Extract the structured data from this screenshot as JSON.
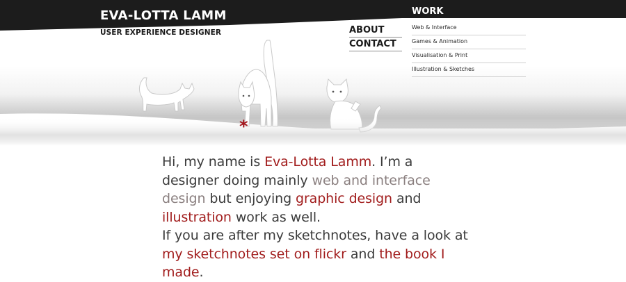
{
  "header": {
    "name": "EVA-LOTTA LAMM",
    "subtitle": "USER EXPERIENCE DESIGNER"
  },
  "nav": {
    "about": "ABOUT",
    "contact": "CONTACT"
  },
  "work_menu": {
    "title": "WORK",
    "items": [
      {
        "label": "Web & Interface"
      },
      {
        "label": "Games & Animation"
      },
      {
        "label": "Visualisation & Print"
      },
      {
        "label": "Illustration & Sketches"
      }
    ]
  },
  "decor": {
    "asterisk": "*",
    "illustration_icon": "cats-illustration"
  },
  "intro": {
    "p1_a": "Hi, my name is ",
    "p1_name_link": "Eva-Lotta Lamm",
    "p1_b": ". I’m a designer doing mainly ",
    "p1_web_link": "web and interface design",
    "p1_c": " but enjoying ",
    "p1_graphic_link": "graphic design",
    "p1_d": " and ",
    "p1_illustration_link": "illustration",
    "p1_e": " work as well.",
    "p2_a": "If you are after my sketchnotes, have a look at ",
    "p2_flickr_link": "my sketchnotes set on flickr",
    "p2_b": " and ",
    "p2_book_link": "the book I made",
    "p2_c": "."
  },
  "colors": {
    "brand_red": "#a11c1c",
    "dark_band": "#1c1c1c",
    "muted_link": "#8a7f7f",
    "body_text": "#3b3b3b"
  }
}
